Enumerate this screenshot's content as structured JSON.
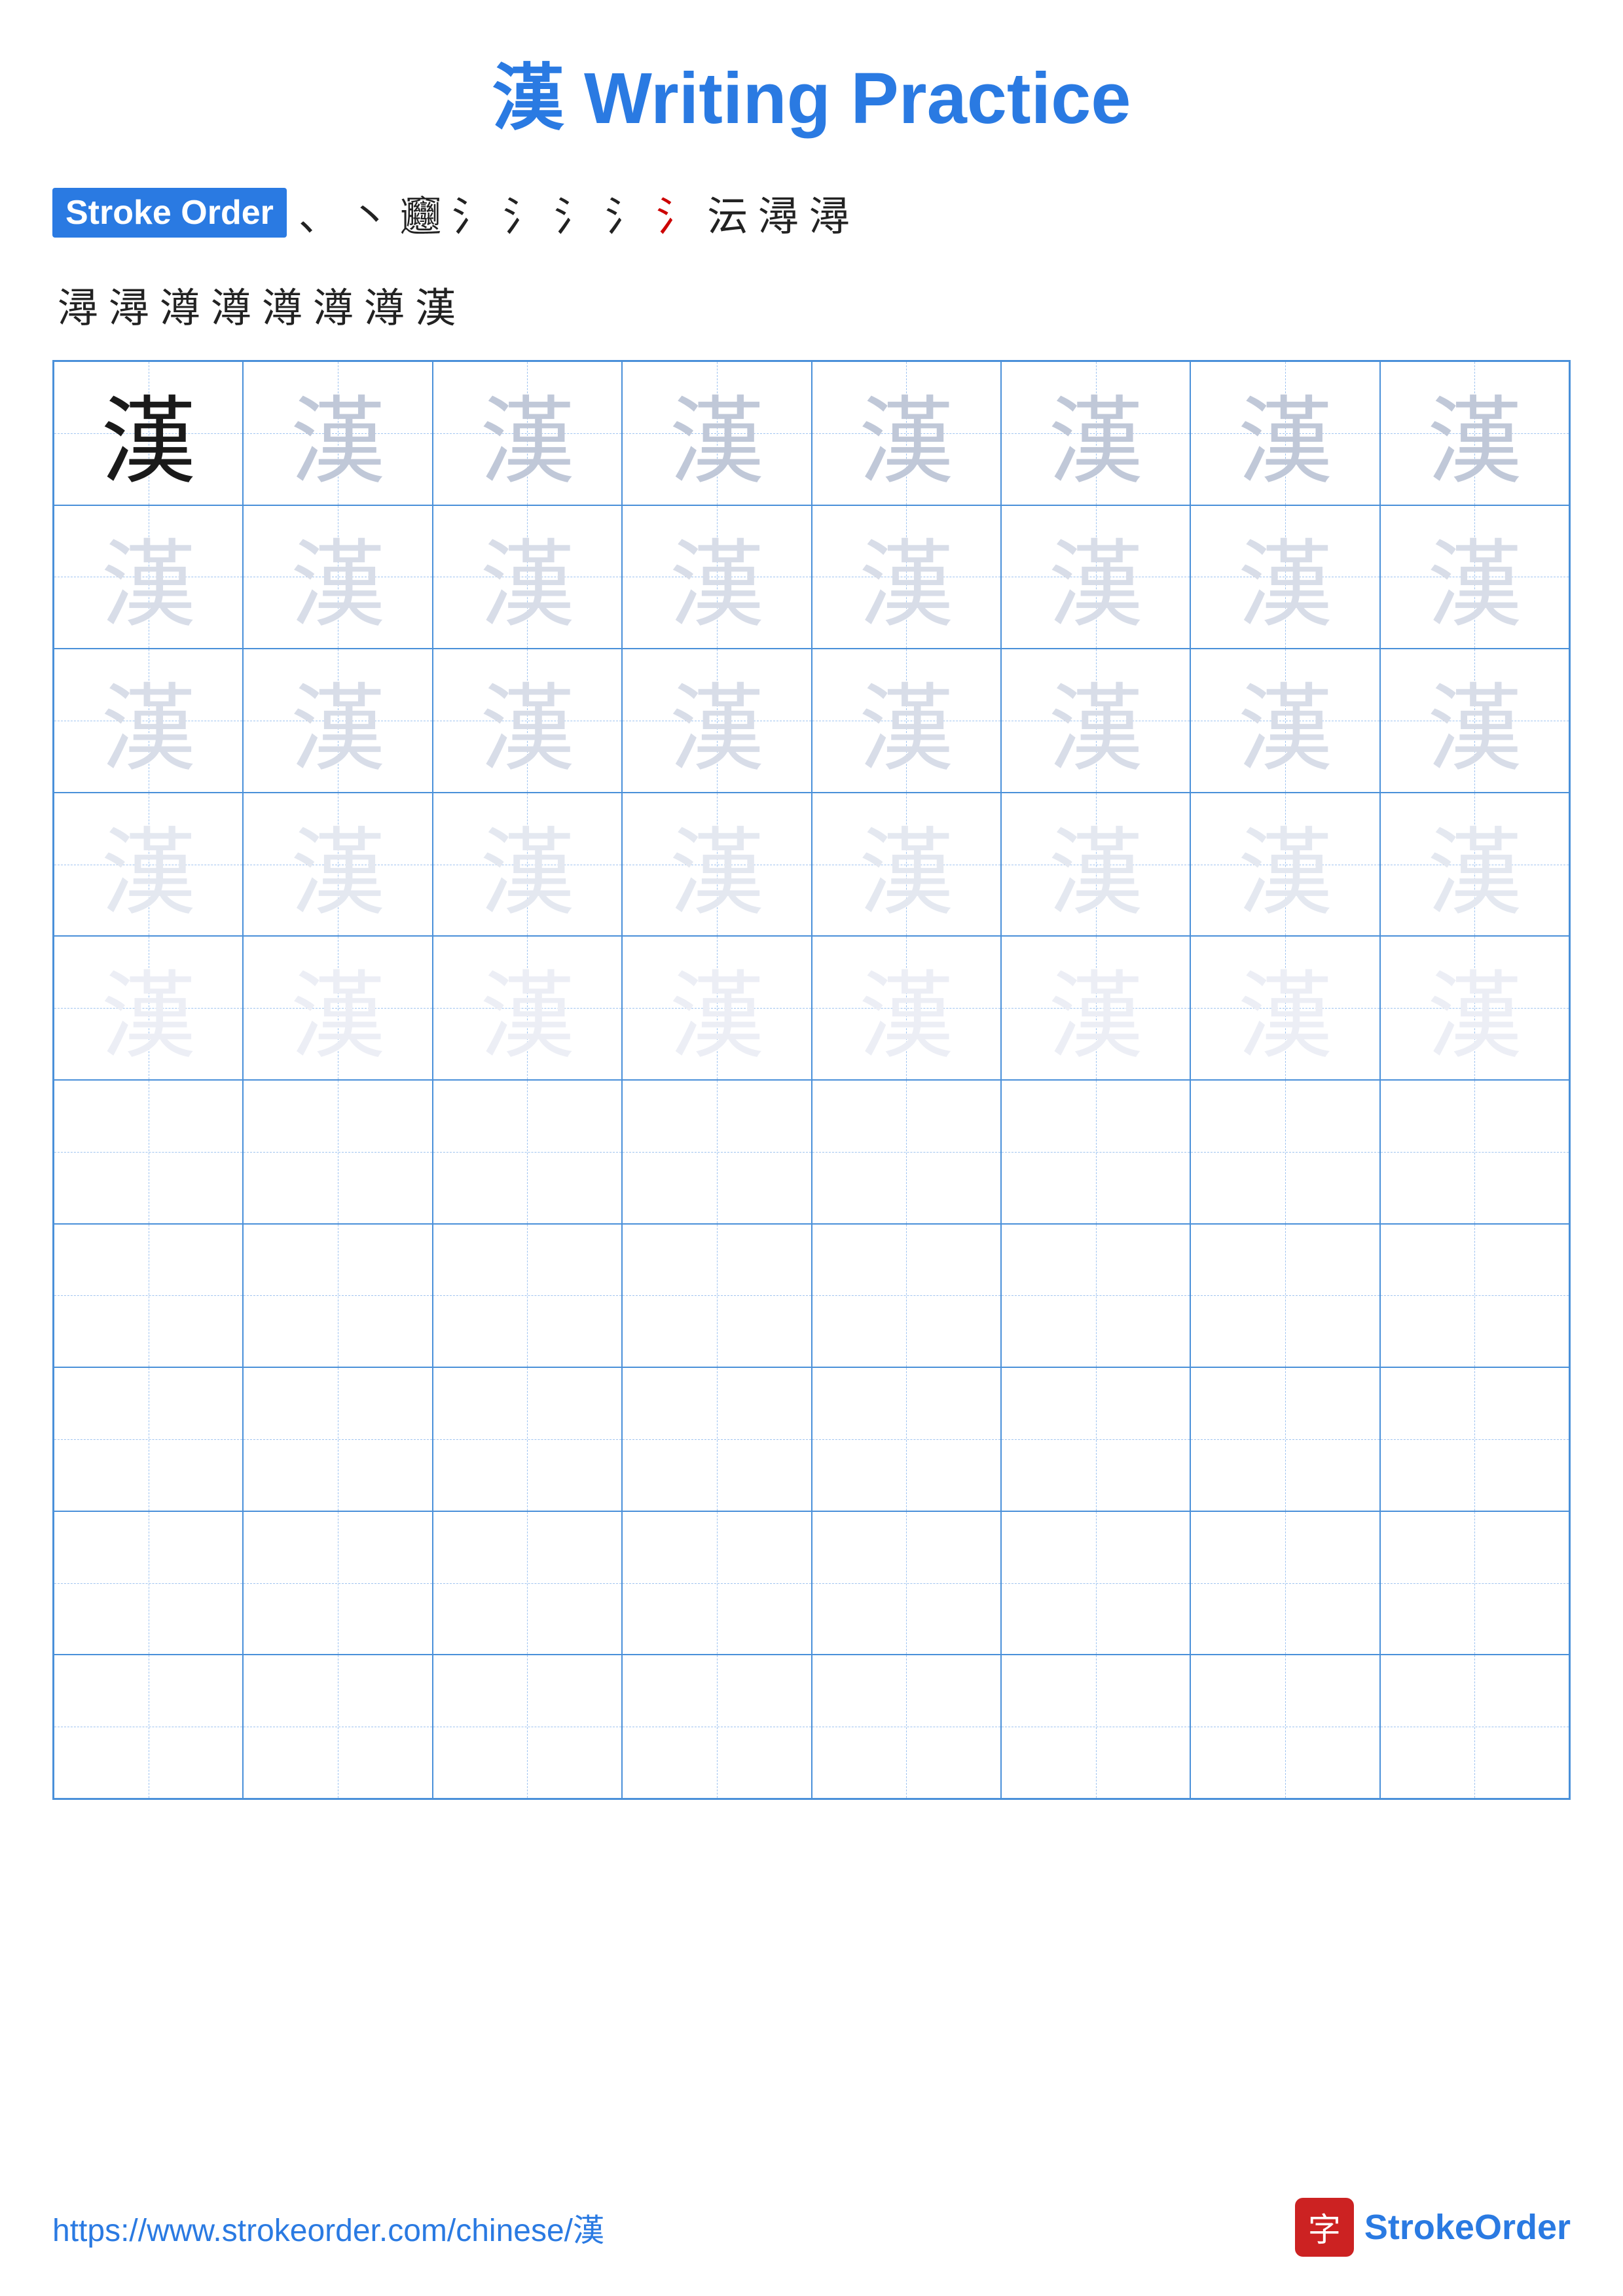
{
  "title": {
    "char": "漢",
    "rest": " Writing Practice"
  },
  "stroke_order": {
    "label": "Stroke Order",
    "chars_row1": [
      "、",
      "丶",
      "氵",
      "氵",
      "氵",
      "氵",
      "氵",
      "氵",
      "沄",
      "沄",
      "潯",
      "潯"
    ],
    "chars_row2": [
      "潯",
      "潯",
      "澊",
      "澊",
      "澊",
      "澊",
      "澊",
      "漢"
    ],
    "red_index": 7
  },
  "grid": {
    "rows": 10,
    "cols": 8,
    "char": "漢",
    "opacity_pattern": [
      "dark",
      "medium-light",
      "medium-light",
      "medium-light",
      "medium-light",
      "medium-light",
      "medium-light",
      "medium-light",
      "light",
      "light",
      "light",
      "light",
      "light",
      "light",
      "light",
      "light",
      "light",
      "light",
      "light",
      "light",
      "light",
      "light",
      "light",
      "light",
      "very-light",
      "very-light",
      "very-light",
      "very-light",
      "very-light",
      "very-light",
      "very-light",
      "very-light",
      "ultra-light",
      "ultra-light",
      "ultra-light",
      "ultra-light",
      "ultra-light",
      "ultra-light",
      "ultra-light",
      "ultra-light",
      "empty",
      "empty",
      "empty",
      "empty",
      "empty",
      "empty",
      "empty",
      "empty",
      "empty",
      "empty",
      "empty",
      "empty",
      "empty",
      "empty",
      "empty",
      "empty",
      "empty",
      "empty",
      "empty",
      "empty",
      "empty",
      "empty",
      "empty",
      "empty",
      "empty",
      "empty",
      "empty",
      "empty",
      "empty",
      "empty",
      "empty",
      "empty",
      "empty",
      "empty",
      "empty",
      "empty",
      "empty",
      "empty",
      "empty",
      "empty"
    ]
  },
  "footer": {
    "url": "https://www.strokeorder.com/chinese/漢",
    "brand_char": "字",
    "brand_text_plain": "StrokeOrder"
  }
}
